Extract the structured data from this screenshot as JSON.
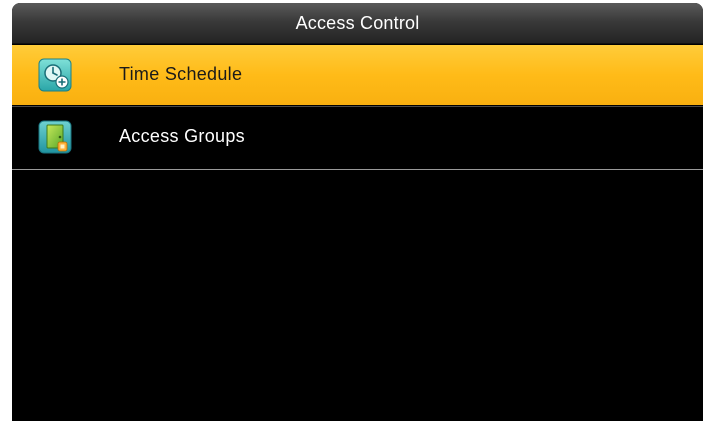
{
  "window": {
    "title": "Access Control"
  },
  "menu": {
    "items": [
      {
        "label": "Time Schedule",
        "icon": "clock-schedule-icon",
        "selected": true
      },
      {
        "label": "Access Groups",
        "icon": "door-group-icon",
        "selected": false
      }
    ]
  },
  "colors": {
    "selected_bg": "#ffbb18",
    "screen_bg": "#000000",
    "title_bg": "#3a3a3a",
    "text_light": "#ffffff",
    "text_dark": "#1a1a1a"
  }
}
